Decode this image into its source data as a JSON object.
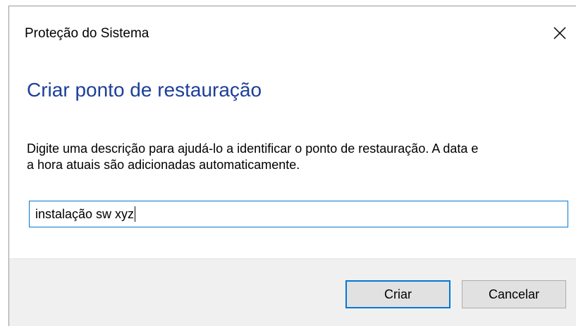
{
  "window": {
    "title": "Proteção do Sistema",
    "close_icon": "close-x-icon"
  },
  "heading": "Criar ponto de restauração",
  "description": {
    "line1": "Digite uma descrição para ajudá-lo a identificar o ponto de restauração. A data e",
    "line2": "a hora atuais são adicionadas automaticamente."
  },
  "input": {
    "value": "instalação sw xyz"
  },
  "buttons": {
    "create_label": "Criar",
    "cancel_label": "Cancelar"
  },
  "colors": {
    "heading": "#1c3f9a",
    "focus_accent": "#0078d7",
    "footer_bg": "#f0f0f0",
    "button_bg": "#e1e1e1"
  }
}
